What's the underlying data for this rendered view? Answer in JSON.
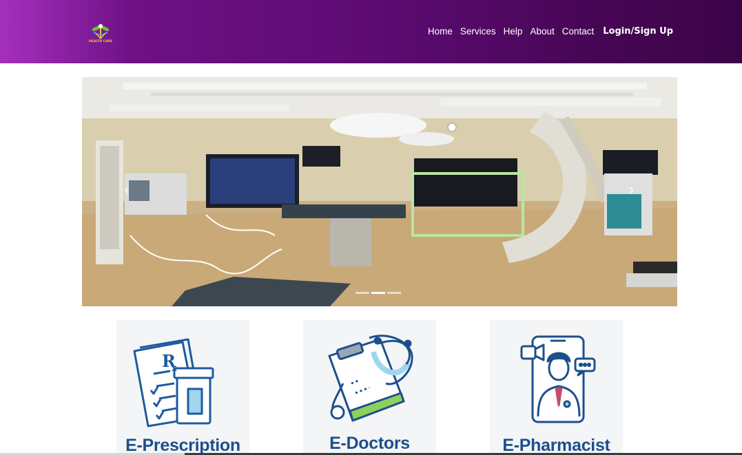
{
  "header": {
    "logo_text": "HEALTH CARE",
    "nav": [
      {
        "label": "Home"
      },
      {
        "label": "Services"
      },
      {
        "label": "Help"
      },
      {
        "label": "About"
      },
      {
        "label": "Contact"
      },
      {
        "label": "Login/Sign Up"
      }
    ]
  },
  "carousel": {
    "prev_icon": "‹",
    "next_icon": "›",
    "slide_count": 3,
    "active_slide": 2,
    "image": "hospital-operating-room-photo"
  },
  "services": [
    {
      "title": "E-Prescription",
      "icon": "prescription-icon"
    },
    {
      "title": "E-Doctors",
      "icon": "clipboard-stethoscope-icon"
    },
    {
      "title": "E-Pharmacist",
      "icon": "phone-video-doctor-icon"
    }
  ],
  "colors": {
    "header_gradient_start": "#a52fbd",
    "header_gradient_end": "#3c0448",
    "card_title": "#1d4f8c",
    "card_bg": "#f4f5f7"
  }
}
